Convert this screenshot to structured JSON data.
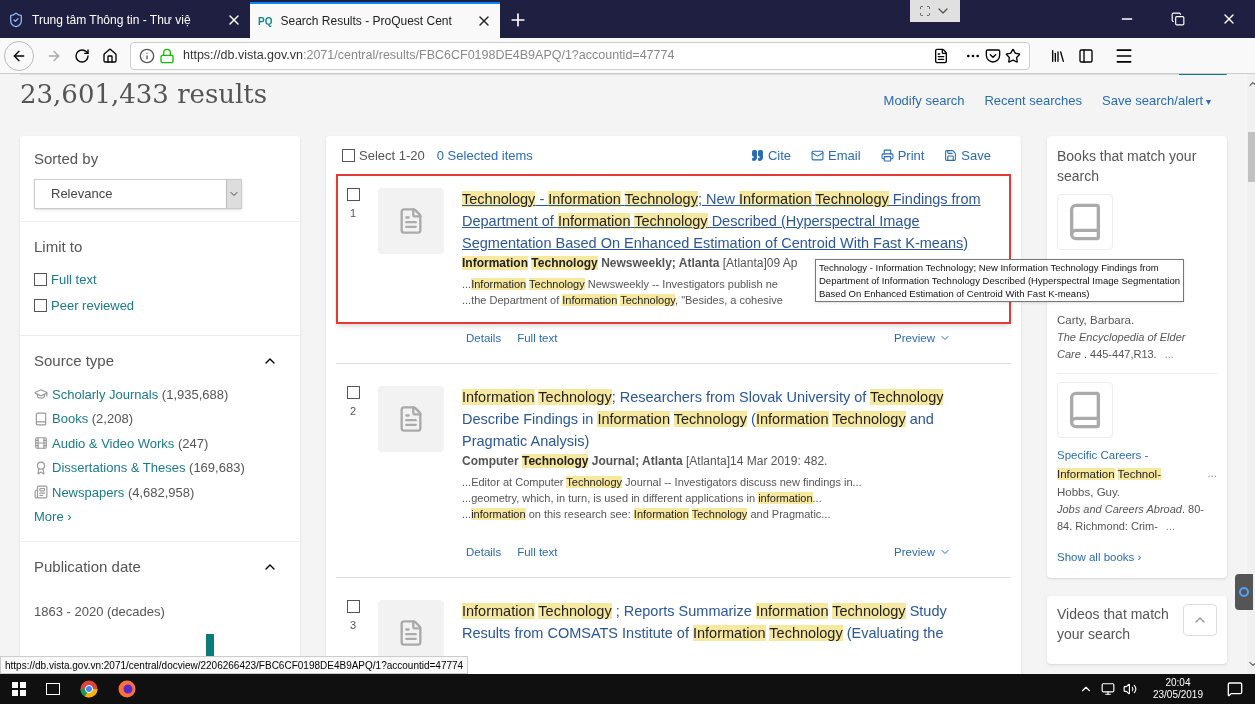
{
  "browser": {
    "tabs": [
      {
        "title": "Trung tâm Thông tin - Thư việ",
        "selected": false
      },
      {
        "favicon_text": "PQ",
        "title": "Search Results - ProQuest Cent",
        "selected": true
      }
    ],
    "url_host": "https://db.vista.gov.vn",
    "url_path": ":2071/central/results/FBC6CF0198DE4B9APQ/1?accountid=47774",
    "status_url": "https://db.vista.gov.vn:2071/central/docview/2206266423/FBC6CF0198DE4B9APQ/1?accountid=47774"
  },
  "header": {
    "results_count": "23,601,433 results",
    "links": [
      {
        "label": "Modify search"
      },
      {
        "label": "Recent searches"
      },
      {
        "label": "Save search/alert",
        "caret": "▾"
      }
    ]
  },
  "sidebar": {
    "sort": {
      "title": "Sorted by",
      "value": "Relevance"
    },
    "limit": {
      "title": "Limit to",
      "options": [
        {
          "label": "Full text",
          "checked": false
        },
        {
          "label": "Peer reviewed",
          "checked": false
        }
      ]
    },
    "source_type": {
      "title": "Source type",
      "expanded": true,
      "items": [
        {
          "kind": "journal",
          "label": "Scholarly Journals",
          "count": "(1,935,688)"
        },
        {
          "kind": "book",
          "label": "Books",
          "count": "(2,208)"
        },
        {
          "kind": "video",
          "label": "Audio & Video Works",
          "count": "(247)"
        },
        {
          "kind": "dissertation",
          "label": "Dissertations & Theses",
          "count": "(169,683)"
        },
        {
          "kind": "newspaper",
          "label": "Newspapers",
          "count": "(4,682,958)"
        }
      ],
      "more": "More ›"
    },
    "publication_date": {
      "title": "Publication date",
      "expanded": true,
      "range": "1863 - 2020 (decades)"
    }
  },
  "toolbar": {
    "select_all": {
      "label": "Select 1-20",
      "checked": false
    },
    "selected_items": "0 Selected items",
    "actions": [
      {
        "kind": "cite",
        "label": "Cite"
      },
      {
        "kind": "email",
        "label": "Email"
      },
      {
        "kind": "print",
        "label": "Print"
      },
      {
        "kind": "save",
        "label": "Save"
      }
    ]
  },
  "results": [
    {
      "number": "1",
      "checked": false,
      "hovered": true,
      "outlined": true,
      "title": [
        {
          "text": "Technology",
          "highlight": true
        },
        {
          "text": " - "
        },
        {
          "text": "Information",
          "highlight": true,
          "space_after": true
        },
        {
          "text": "Technology",
          "highlight": true
        },
        {
          "text": "; New "
        },
        {
          "text": "Information",
          "highlight": true,
          "space_after": true
        },
        {
          "text": "Technology",
          "highlight": true
        },
        {
          "text": " Findings from Department of "
        },
        {
          "text": "Information",
          "highlight": true,
          "space_after": true
        },
        {
          "text": "Technology",
          "highlight": true
        },
        {
          "text": " Described (Hyperspectral Image Segmentation Based On Enhanced Estimation of Centroid With Fast K-means)"
        }
      ],
      "source": [
        {
          "text": "Information",
          "highlight": true,
          "bold": true,
          "space_after": true
        },
        {
          "text": "Technology",
          "highlight": true,
          "bold": true
        },
        {
          "text": " Newsweekly; Atlanta",
          "bold": true
        },
        {
          "text": " [Atlanta]09 Ap"
        }
      ],
      "snippets": [
        [
          {
            "text": "..."
          },
          {
            "text": "Information",
            "highlight": true,
            "space_after": true
          },
          {
            "text": "Technology",
            "highlight": true
          },
          {
            "text": " Newsweekly -- Investigators publish ne"
          }
        ],
        [
          {
            "text": "...the Department of "
          },
          {
            "text": "Information",
            "highlight": true,
            "space_after": true
          },
          {
            "text": "Technology",
            "highlight": true
          },
          {
            "text": ", \"Besides, a cohesive"
          }
        ]
      ],
      "links": [
        "Details",
        "Full text"
      ],
      "preview": "Preview"
    },
    {
      "number": "2",
      "checked": false,
      "hovered": false,
      "outlined": false,
      "title": [
        {
          "text": "Information",
          "highlight": true,
          "space_after": true
        },
        {
          "text": "Technology",
          "highlight": true
        },
        {
          "text": "; Researchers from Slovak University of "
        },
        {
          "text": "Technology",
          "highlight": true
        },
        {
          "text": " Describe Findings in "
        },
        {
          "text": "Information",
          "highlight": true,
          "space_after": true
        },
        {
          "text": "Technology",
          "highlight": true
        },
        {
          "text": " ("
        },
        {
          "text": "Information",
          "highlight": true,
          "space_after": true
        },
        {
          "text": "Technology",
          "highlight": true
        },
        {
          "text": " and Pragmatic Analysis)"
        }
      ],
      "source": [
        {
          "text": "Computer ",
          "bold": true
        },
        {
          "text": "Technology",
          "highlight": true,
          "bold": true
        },
        {
          "text": " Journal; Atlanta",
          "bold": true
        },
        {
          "text": " [Atlanta]14 Mar 2019: 482."
        }
      ],
      "snippets": [
        [
          {
            "text": "...Editor at Computer "
          },
          {
            "text": "Technology",
            "highlight": true
          },
          {
            "text": " Journal -- Investigators discuss new findings in..."
          }
        ],
        [
          {
            "text": "...geometry, which, in turn, is used in different applications in "
          },
          {
            "text": "information",
            "highlight": true
          },
          {
            "text": "..."
          }
        ],
        [
          {
            "text": "..."
          },
          {
            "text": "information",
            "highlight": true
          },
          {
            "text": " on this research see: "
          },
          {
            "text": "Information",
            "highlight": true,
            "space_after": true
          },
          {
            "text": "Technology",
            "highlight": true
          },
          {
            "text": " and Pragmatic..."
          }
        ]
      ],
      "links": [
        "Details",
        "Full text"
      ],
      "preview": "Preview"
    },
    {
      "number": "3",
      "checked": false,
      "hovered": false,
      "outlined": false,
      "title": [
        {
          "text": "Information",
          "highlight": true,
          "space_after": true
        },
        {
          "text": "Technology",
          "highlight": true
        },
        {
          "text": " ; Reports Summarize "
        },
        {
          "text": "Information",
          "highlight": true,
          "space_after": true
        },
        {
          "text": "Technology",
          "highlight": true
        },
        {
          "text": " Study Results from COMSATS Institute of "
        },
        {
          "text": "Information",
          "highlight": true,
          "space_after": true
        },
        {
          "text": "Technology",
          "highlight": true
        },
        {
          "text": " (Evaluating the"
        }
      ]
    }
  ],
  "tooltip": [
    "Technology - Information Technology; New Information Technology Findings from",
    "Department of Information Technology Described (Hyperspectral Image Segmentation",
    "Based On Enhanced Estimation of Centroid With Fast K-means)"
  ],
  "books": {
    "title": "Books that match your search",
    "items": [
      {
        "author": "Carty, Barbara.",
        "book": "The Encyclopedia of Elder Care",
        "detail": " . 445-447,R13.",
        "more": "..."
      },
      {
        "title": [
          {
            "text": "Specific Careers - "
          },
          {
            "text": "Information",
            "highlight": true,
            "space_after": true
          },
          {
            "text": "Technol-",
            "highlight": true
          }
        ],
        "title_more": "...",
        "author": "Hobbs, Guy.",
        "book": "Jobs and Careers Abroad",
        "detail": ". 80-84. Richmond: Crim-",
        "more": "..."
      }
    ],
    "show_all": "Show all books ›"
  },
  "videos": {
    "title": "Videos that match your search"
  },
  "taskbar": {
    "time": "20:04",
    "date": "23/05/2019"
  }
}
